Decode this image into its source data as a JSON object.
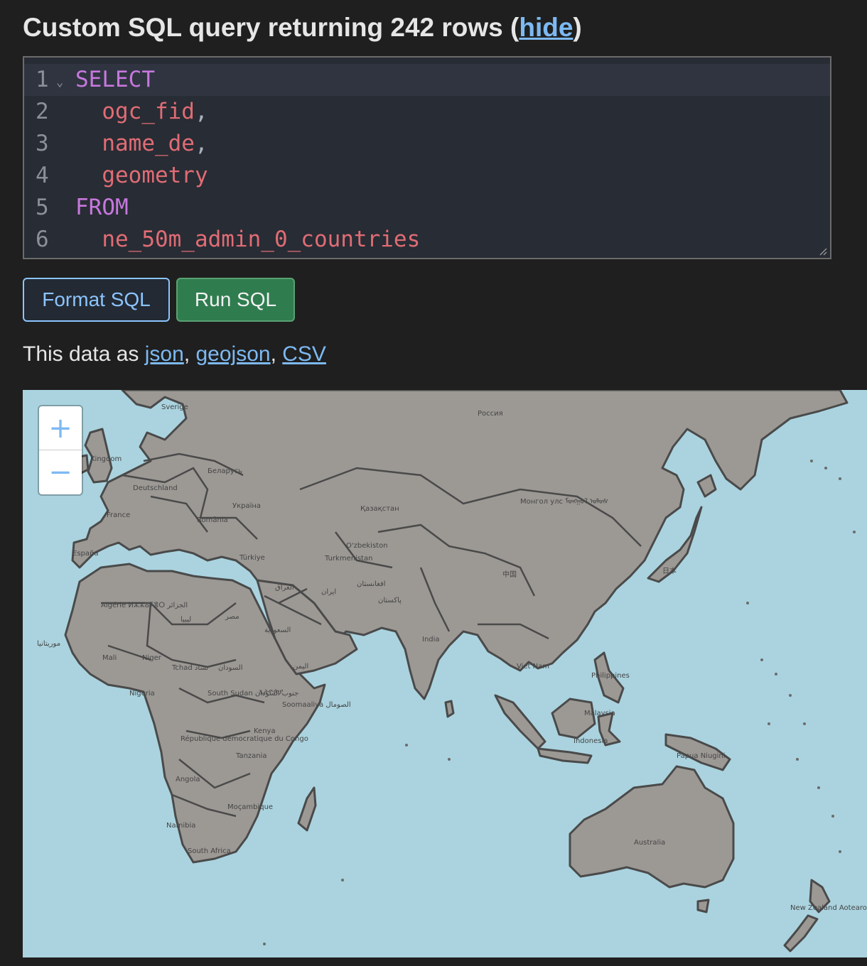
{
  "header": {
    "title_prefix": "Custom SQL query returning 242 rows (",
    "hide_link": "hide",
    "title_suffix": ")"
  },
  "editor": {
    "lines": [
      {
        "no": "1",
        "tokens": [
          {
            "t": "SELECT",
            "c": "kw"
          }
        ]
      },
      {
        "no": "2",
        "tokens": [
          {
            "t": "  ",
            "c": "pn"
          },
          {
            "t": "ogc_fid",
            "c": "id"
          },
          {
            "t": ",",
            "c": "pn"
          }
        ]
      },
      {
        "no": "3",
        "tokens": [
          {
            "t": "  ",
            "c": "pn"
          },
          {
            "t": "name_de",
            "c": "id"
          },
          {
            "t": ",",
            "c": "pn"
          }
        ]
      },
      {
        "no": "4",
        "tokens": [
          {
            "t": "  ",
            "c": "pn"
          },
          {
            "t": "geometry",
            "c": "id"
          }
        ]
      },
      {
        "no": "5",
        "tokens": [
          {
            "t": "FROM",
            "c": "kw"
          }
        ]
      },
      {
        "no": "6",
        "tokens": [
          {
            "t": "  ",
            "c": "pn"
          },
          {
            "t": "ne_50m_admin_0_countries",
            "c": "id"
          }
        ]
      }
    ]
  },
  "buttons": {
    "format_label": "Format SQL",
    "run_label": "Run SQL"
  },
  "export": {
    "prefix": "This data as ",
    "json": "json",
    "sep1": ", ",
    "geojson": "geojson",
    "sep2": ", ",
    "csv": "CSV"
  },
  "map": {
    "zoom_in": "+",
    "zoom_out": "−",
    "labels": [
      "Россия",
      "Sverige",
      "Kingdom",
      "Беларусь",
      "Deutschland",
      "Україна",
      "France",
      "România",
      "Қазақстан",
      "Монгол улс ᠮᠣᠩᠭᠣᠯ ᠤᠯᠤᠰ",
      "España",
      "Türkiye",
      "O'zbekiston",
      "Turkmenistan",
      "中国",
      "日本",
      "Algérie ⵍⵣⵣⴰⵢⴻⵔ الجزائر",
      "ليبيا",
      "مصر",
      "العراق",
      "ایران",
      "افغانستان",
      "پاکستان",
      "السعودية",
      "India",
      "موريتانيا",
      "Mali",
      "Niger",
      "Tchad تشاد",
      "السودان",
      "اليمن",
      "Nigeria",
      "South Sudan جنوب السودان",
      "ኢትዮጵያ",
      "Soomaaliya الصومال",
      "Viet Nam",
      "Philippines",
      "Malaysia",
      "Kenya",
      "République démocratique du Congo",
      "Tanzania",
      "Indonesia",
      "Papua Niugini",
      "Angola",
      "Moçambique",
      "Namibia",
      "South Africa",
      "Australia",
      "New Zealand Aotearoa"
    ],
    "colors": {
      "water": "#aad3df",
      "land": "#9c9995",
      "border": "#4a4a4a"
    }
  }
}
